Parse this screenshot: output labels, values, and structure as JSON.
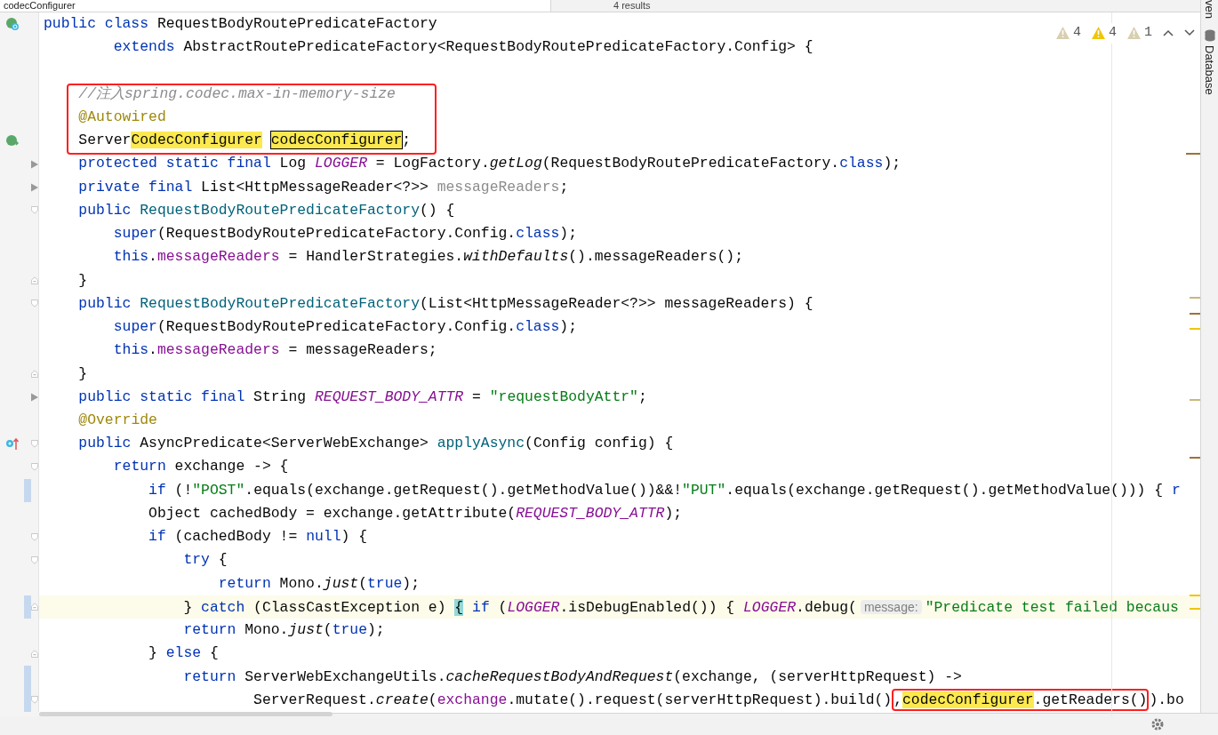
{
  "search": {
    "value": "codecConfigurer",
    "results": "4 results"
  },
  "inspections": [
    {
      "kind": "weak",
      "count": "4"
    },
    {
      "kind": "warning",
      "count": "4"
    },
    {
      "kind": "weak",
      "count": "1"
    }
  ],
  "tool_windows": [
    {
      "kind": "plain",
      "label": "ven"
    },
    {
      "kind": "database",
      "label": "Database"
    }
  ],
  "lines": [
    {
      "gutter_icon": {
        "kind": "class"
      },
      "current": false,
      "changed": false,
      "boxed": false,
      "tokens": [
        {
          "kind": "kw",
          "text": "public class "
        },
        {
          "kind": "plain",
          "text": "RequestBodyRoutePredicateFactory"
        }
      ]
    },
    {
      "current": false,
      "changed": false,
      "boxed": false,
      "tokens": [
        {
          "kind": "kw",
          "text": "        extends "
        },
        {
          "kind": "plain",
          "text": "AbstractRoutePredicateFactory<RequestBodyRoutePredicateFactory.Config> {"
        }
      ]
    },
    {
      "current": false,
      "changed": false,
      "boxed": false
    },
    {
      "current": false,
      "changed": false,
      "boxed": true,
      "tokens": [
        {
          "kind": "comment",
          "text": "    //注入spring.codec.max-in-memory-size"
        }
      ]
    },
    {
      "current": false,
      "changed": false,
      "boxed": true,
      "tokens": [
        {
          "kind": "annotation",
          "text": "    @Autowired"
        }
      ]
    },
    {
      "gutter_icon": {
        "kind": "bean"
      },
      "current": false,
      "changed": false,
      "boxed": true,
      "tokens": [
        {
          "kind": "plain",
          "text": "    Server"
        },
        {
          "kind": "hl",
          "text": "CodecConfigurer "
        },
        {
          "kind": "hl_current",
          "text": "codecConfigurer"
        },
        {
          "kind": "plain",
          "text": ";"
        }
      ]
    },
    {
      "fold_marker": {
        "kind": "collapsed"
      },
      "current": false,
      "changed": false,
      "boxed": false,
      "tokens": [
        {
          "kind": "kw",
          "text": "    protected static final "
        },
        {
          "kind": "plain",
          "text": "Log "
        },
        {
          "kind": "static_field",
          "text": "LOGGER"
        },
        {
          "kind": "plain",
          "text": " = LogFactory."
        },
        {
          "kind": "static_call",
          "text": "getLog"
        },
        {
          "kind": "plain",
          "text": "(RequestBodyRoutePredicateFactory."
        },
        {
          "kind": "kw",
          "text": "class"
        },
        {
          "kind": "plain",
          "text": ");"
        }
      ]
    },
    {
      "fold_marker": {
        "kind": "collapsed"
      },
      "current": false,
      "changed": false,
      "boxed": false,
      "tokens": [
        {
          "kind": "kw",
          "text": "    private final "
        },
        {
          "kind": "plain",
          "text": "List<HttpMessageReader<?>> "
        },
        {
          "kind": "unused",
          "text": "messageReaders"
        },
        {
          "kind": "plain",
          "text": ";"
        }
      ]
    },
    {
      "fold_marker": {
        "kind": "open"
      },
      "current": false,
      "changed": false,
      "boxed": false,
      "tokens": [
        {
          "kind": "kw",
          "text": "    public "
        },
        {
          "kind": "decl",
          "text": "RequestBodyRoutePredicateFactory"
        },
        {
          "kind": "plain",
          "text": "() {"
        }
      ]
    },
    {
      "current": false,
      "changed": false,
      "boxed": false,
      "tokens": [
        {
          "kind": "kw",
          "text": "        super"
        },
        {
          "kind": "plain",
          "text": "(RequestBodyRoutePredicateFactory.Config."
        },
        {
          "kind": "kw",
          "text": "class"
        },
        {
          "kind": "plain",
          "text": ");"
        }
      ]
    },
    {
      "current": false,
      "changed": false,
      "boxed": false,
      "tokens": [
        {
          "kind": "kw",
          "text": "        this"
        },
        {
          "kind": "plain",
          "text": "."
        },
        {
          "kind": "field",
          "text": "messageReaders"
        },
        {
          "kind": "plain",
          "text": " = HandlerStrategies."
        },
        {
          "kind": "static_call",
          "text": "withDefaults"
        },
        {
          "kind": "plain",
          "text": "().messageReaders();"
        }
      ]
    },
    {
      "fold_marker": {
        "kind": "close"
      },
      "current": false,
      "changed": false,
      "boxed": false,
      "tokens": [
        {
          "kind": "plain",
          "text": "    }"
        }
      ]
    },
    {
      "fold_marker": {
        "kind": "open"
      },
      "current": false,
      "changed": false,
      "boxed": false,
      "tokens": [
        {
          "kind": "kw",
          "text": "    public "
        },
        {
          "kind": "decl",
          "text": "RequestBodyRoutePredicateFactory"
        },
        {
          "kind": "plain",
          "text": "(List<HttpMessageReader<?>> messageReaders) {"
        }
      ]
    },
    {
      "current": false,
      "changed": false,
      "boxed": false,
      "tokens": [
        {
          "kind": "kw",
          "text": "        super"
        },
        {
          "kind": "plain",
          "text": "(RequestBodyRoutePredicateFactory.Config."
        },
        {
          "kind": "kw",
          "text": "class"
        },
        {
          "kind": "plain",
          "text": ");"
        }
      ]
    },
    {
      "current": false,
      "changed": false,
      "boxed": false,
      "tokens": [
        {
          "kind": "kw",
          "text": "        this"
        },
        {
          "kind": "plain",
          "text": "."
        },
        {
          "kind": "field",
          "text": "messageReaders"
        },
        {
          "kind": "plain",
          "text": " = messageReaders;"
        }
      ]
    },
    {
      "fold_marker": {
        "kind": "close"
      },
      "current": false,
      "changed": false,
      "boxed": false,
      "tokens": [
        {
          "kind": "plain",
          "text": "    }"
        }
      ]
    },
    {
      "fold_marker": {
        "kind": "collapsed"
      },
      "current": false,
      "changed": false,
      "boxed": false,
      "tokens": [
        {
          "kind": "kw",
          "text": "    public static final "
        },
        {
          "kind": "plain",
          "text": "String "
        },
        {
          "kind": "static_field",
          "text": "REQUEST_BODY_ATTR"
        },
        {
          "kind": "plain",
          "text": " = "
        },
        {
          "kind": "string",
          "text": "\"requestBodyAttr\""
        },
        {
          "kind": "plain",
          "text": ";"
        }
      ]
    },
    {
      "current": false,
      "changed": false,
      "boxed": false,
      "tokens": [
        {
          "kind": "annotation",
          "text": "    @Override"
        }
      ]
    },
    {
      "gutter_icon": {
        "kind": "override"
      },
      "fold_marker": {
        "kind": "open"
      },
      "current": false,
      "changed": false,
      "boxed": false,
      "tokens": [
        {
          "kind": "kw",
          "text": "    public "
        },
        {
          "kind": "plain",
          "text": "AsyncPredicate<ServerWebExchange> "
        },
        {
          "kind": "decl",
          "text": "applyAsync"
        },
        {
          "kind": "plain",
          "text": "(Config config) {"
        }
      ]
    },
    {
      "fold_marker": {
        "kind": "open"
      },
      "current": false,
      "changed": false,
      "boxed": false,
      "tokens": [
        {
          "kind": "kw",
          "text": "        return "
        },
        {
          "kind": "plain",
          "text": "exchange -> {"
        }
      ]
    },
    {
      "current": false,
      "changed": true,
      "boxed": false,
      "tokens": [
        {
          "kind": "kw",
          "text": "            if "
        },
        {
          "kind": "plain",
          "text": "(!"
        },
        {
          "kind": "string",
          "text": "\"POST\""
        },
        {
          "kind": "plain",
          "text": ".equals(exchange.getRequest().getMethodValue())&&!"
        },
        {
          "kind": "string",
          "text": "\"PUT\""
        },
        {
          "kind": "plain",
          "text": ".equals(exchange.getRequest().getMethodValue())) { "
        },
        {
          "kind": "kw",
          "text": "r"
        }
      ]
    },
    {
      "current": false,
      "changed": false,
      "boxed": false,
      "tokens": [
        {
          "kind": "plain",
          "text": "            Object cachedBody = exchange.getAttribute("
        },
        {
          "kind": "static_field",
          "text": "REQUEST_BODY_ATTR"
        },
        {
          "kind": "plain",
          "text": ");"
        }
      ]
    },
    {
      "fold_marker": {
        "kind": "open"
      },
      "current": false,
      "changed": false,
      "boxed": false,
      "tokens": [
        {
          "kind": "kw",
          "text": "            if "
        },
        {
          "kind": "plain",
          "text": "(cachedBody != "
        },
        {
          "kind": "kw",
          "text": "null"
        },
        {
          "kind": "plain",
          "text": ") {"
        }
      ]
    },
    {
      "fold_marker": {
        "kind": "open"
      },
      "current": false,
      "changed": false,
      "boxed": false,
      "tokens": [
        {
          "kind": "kw",
          "text": "                try "
        },
        {
          "kind": "plain",
          "text": "{"
        }
      ]
    },
    {
      "current": false,
      "changed": false,
      "boxed": false,
      "tokens": [
        {
          "kind": "kw",
          "text": "                    return "
        },
        {
          "kind": "plain",
          "text": "Mono."
        },
        {
          "kind": "static_call",
          "text": "just"
        },
        {
          "kind": "plain",
          "text": "("
        },
        {
          "kind": "kw",
          "text": "true"
        },
        {
          "kind": "plain",
          "text": ");"
        }
      ]
    },
    {
      "fold_marker": {
        "kind": "close"
      },
      "current": true,
      "changed": true,
      "boxed": false,
      "tokens": [
        {
          "kind": "plain",
          "text": "                } "
        },
        {
          "kind": "kw",
          "text": "catch "
        },
        {
          "kind": "plain",
          "text": "(ClassCastException e) "
        },
        {
          "kind": "brace",
          "text": "{ "
        },
        {
          "kind": "kw",
          "text": "if "
        },
        {
          "kind": "plain",
          "text": "("
        },
        {
          "kind": "static_field",
          "text": "LOGGER"
        },
        {
          "kind": "plain",
          "text": ".isDebugEnabled()) { "
        },
        {
          "kind": "static_field",
          "text": "LOGGER"
        },
        {
          "kind": "plain",
          "text": ".debug("
        },
        {
          "kind": "hint",
          "text": "message:"
        },
        {
          "kind": "string",
          "text": "\"Predicate test failed becaus"
        }
      ]
    },
    {
      "current": false,
      "changed": false,
      "boxed": false,
      "tokens": [
        {
          "kind": "kw",
          "text": "                return "
        },
        {
          "kind": "plain",
          "text": "Mono."
        },
        {
          "kind": "static_call",
          "text": "just"
        },
        {
          "kind": "plain",
          "text": "("
        },
        {
          "kind": "kw",
          "text": "true"
        },
        {
          "kind": "plain",
          "text": ");"
        }
      ]
    },
    {
      "fold_marker": {
        "kind": "close"
      },
      "current": false,
      "changed": false,
      "boxed": false,
      "tokens": [
        {
          "kind": "plain",
          "text": "            } "
        },
        {
          "kind": "kw",
          "text": "else "
        },
        {
          "kind": "plain",
          "text": "{"
        }
      ]
    },
    {
      "current": false,
      "changed": true,
      "boxed": false,
      "tokens": [
        {
          "kind": "kw",
          "text": "                return "
        },
        {
          "kind": "plain",
          "text": "ServerWebExchangeUtils."
        },
        {
          "kind": "static_call",
          "text": "cacheRequestBodyAndRequest"
        },
        {
          "kind": "plain",
          "text": "(exchange, (serverHttpRequest) ->"
        }
      ]
    },
    {
      "fold_marker": {
        "kind": "open"
      },
      "current": false,
      "changed": true,
      "boxed": false,
      "tokens": [
        {
          "kind": "plain",
          "text": "                        ServerRequest."
        },
        {
          "kind": "static_call",
          "text": "create"
        },
        {
          "kind": "plain",
          "text": "("
        },
        {
          "kind": "field",
          "text": "exchange"
        },
        {
          "kind": "plain",
          "text": ".mutate().request(serverHttpRequest).build()"
        },
        {
          "kind": "box",
          "tokens": [
            {
              "kind": "plain",
              "text": ","
            },
            {
              "kind": "hl",
              "text": "codecConfigurer"
            },
            {
              "kind": "plain",
              "text": ".getReaders()"
            }
          ]
        },
        {
          "kind": "plain",
          "text": ").bo"
        }
      ]
    }
  ]
}
